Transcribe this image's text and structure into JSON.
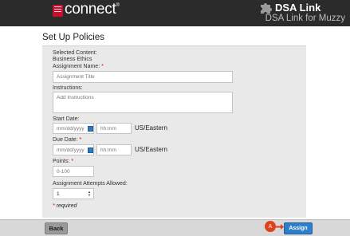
{
  "header": {
    "brand": "connect",
    "brand_mark": "®",
    "logo_text": "Mc Graw Hill Education",
    "app_title": "DSA Link",
    "app_subtitle": "DSA Link for Muzzy"
  },
  "page": {
    "title": "Set Up Policies"
  },
  "form": {
    "selected_content_label": "Selected Content:",
    "selected_content_value": "Business Ethics",
    "assignment_name_label": "Assignment Name:",
    "assignment_name_placeholder": "Assignment Title",
    "instructions_label": "Instructions:",
    "instructions_placeholder": "Add Instructions",
    "start_date_label": "Start Date:",
    "start_date_placeholder": "mm/dd/yyyy",
    "start_time_placeholder": "hh:mm",
    "start_timezone": "US/Eastern",
    "due_date_label": "Due Date:",
    "due_date_placeholder": "mm/dd/yyyy",
    "due_time_placeholder": "hh:mm",
    "due_timezone": "US/Eastern",
    "points_label": "Points:",
    "points_placeholder": "0-100",
    "attempts_label": "Assignment Attempts Allowed:",
    "attempts_value": "1",
    "required_star": "*",
    "required_note": "required"
  },
  "footer": {
    "back_label": "Back",
    "callout_label": "A",
    "assign_label": "Assign"
  },
  "colors": {
    "header_bg": "#2b2b2b",
    "brand_red": "#c8102e",
    "required_red": "#d0021b",
    "assign_blue": "#2d7fc9",
    "callout_orange": "#e0401c"
  },
  "icons": [
    "mcgraw-hill-logo-icon",
    "puzzle-piece-icon",
    "calendar-icon",
    "select-arrows-icon",
    "arrow-right-icon"
  ]
}
